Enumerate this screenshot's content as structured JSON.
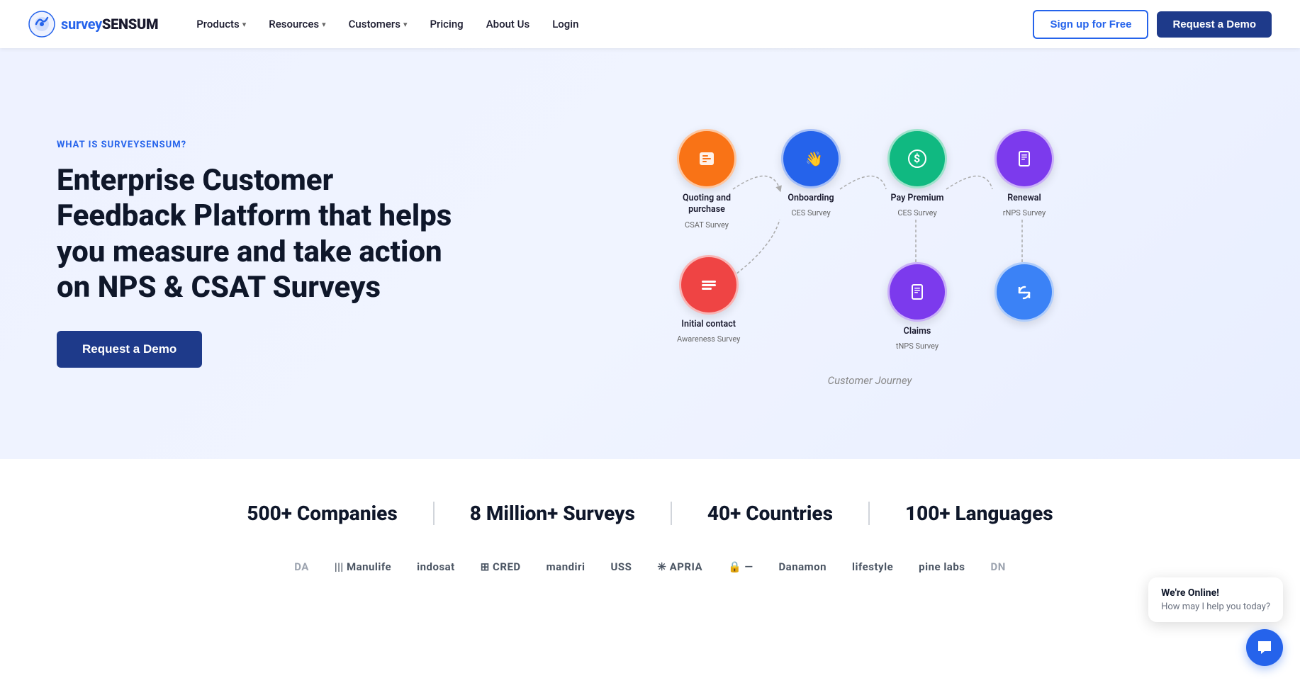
{
  "brand": {
    "name_prefix": "survey",
    "name_suffix": "SENSUM",
    "tagline": "WHAT IS SURVEYSENSUM?"
  },
  "navbar": {
    "products_label": "Products",
    "resources_label": "Resources",
    "customers_label": "Customers",
    "pricing_label": "Pricing",
    "about_label": "About Us",
    "login_label": "Login",
    "signup_label": "Sign up for Free",
    "demo_label": "Request a Demo"
  },
  "hero": {
    "eyebrow": "WHAT IS SURVEYSENSUM?",
    "title": "Enterprise Customer Feedback Platform that helps you measure and take action on NPS & CSAT Surveys",
    "cta_label": "Request a Demo"
  },
  "journey": {
    "caption": "Customer Journey",
    "nodes": [
      {
        "id": "quoting",
        "label": "Quoting and purchase",
        "sublabel": "CSAT Survey",
        "color": "orange",
        "icon": "💬",
        "col": 0,
        "row": 0
      },
      {
        "id": "initial",
        "label": "Initial contact",
        "sublabel": "Awareness Survey",
        "color": "red-orange",
        "icon": "☰",
        "col": 0,
        "row": 1
      },
      {
        "id": "onboarding",
        "label": "Onboarding",
        "sublabel": "CES Survey",
        "color": "blue",
        "icon": "👋",
        "col": 1,
        "row": 0
      },
      {
        "id": "paypremium",
        "label": "Pay Premium",
        "sublabel": "CES Survey",
        "color": "green",
        "icon": "$",
        "col": 2,
        "row": 0
      },
      {
        "id": "claims",
        "label": "Claims",
        "sublabel": "tNPS Survey",
        "color": "purple",
        "icon": "📋",
        "col": 2,
        "row": 1
      },
      {
        "id": "renewal",
        "label": "Renewal",
        "sublabel": "rNPS Survey",
        "color": "purple",
        "icon": "📋",
        "col": 3,
        "row": 0
      },
      {
        "id": "retention",
        "label": "",
        "sublabel": "",
        "color": "blue-bright",
        "icon": "🔄",
        "col": 3,
        "row": 1
      }
    ]
  },
  "stats": [
    {
      "value": "500+ Companies"
    },
    {
      "value": "8 Million+ Surveys"
    },
    {
      "value": "40+ Countries"
    },
    {
      "value": "100+ Languages"
    }
  ],
  "brands": [
    {
      "name": "DA",
      "style": "muted"
    },
    {
      "name": "|||  Manulife",
      "style": "normal"
    },
    {
      "name": "indosat",
      "style": "normal"
    },
    {
      "name": "⊞ CRED",
      "style": "normal"
    },
    {
      "name": "mandiri",
      "style": "normal"
    },
    {
      "name": "USS",
      "style": "normal"
    },
    {
      "name": "✳ APRIA",
      "style": "normal"
    },
    {
      "name": "🔒 —",
      "style": "normal"
    },
    {
      "name": "Danamon",
      "style": "normal"
    },
    {
      "name": "lifestyle",
      "style": "normal"
    },
    {
      "name": "pine labs",
      "style": "normal"
    },
    {
      "name": "DN",
      "style": "muted"
    }
  ],
  "chat": {
    "online_label": "We're Online!",
    "prompt_label": "How may I help you today?",
    "icon": "💬"
  }
}
